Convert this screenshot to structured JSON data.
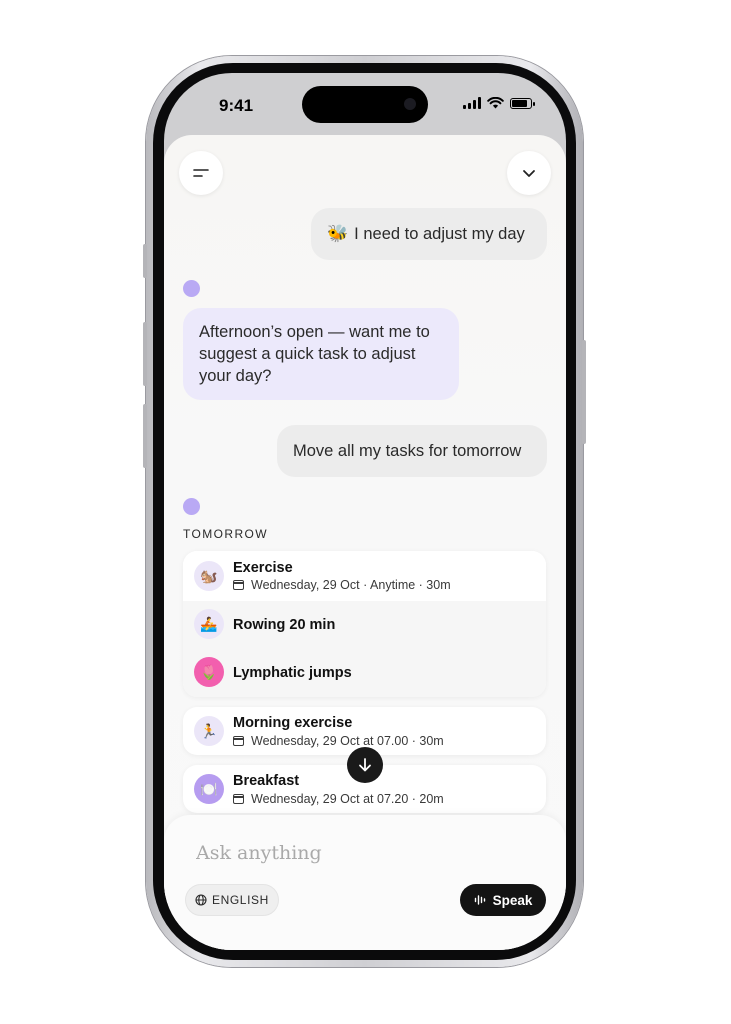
{
  "status_bar": {
    "time": "9:41",
    "battery_level": 0.85
  },
  "header": {
    "menu_icon": "menu-lines-icon",
    "collapse_icon": "chevron-down-icon"
  },
  "chat": {
    "messages": [
      {
        "role": "user",
        "emoji": "🐝",
        "text": "I need to adjust my day"
      },
      {
        "role": "assistant",
        "text": "Afternoon’s open — want me to suggest a quick task to adjust your day?"
      },
      {
        "role": "user",
        "text": "Move all my tasks for tomorrow"
      }
    ],
    "section_label": "TOMORROW",
    "group_card": {
      "tasks": [
        {
          "title": "Exercise",
          "meta": "Wednesday, 29 Oct · Anytime · 30m",
          "icon": "🐿️",
          "icon_bg": "#ebe6f8"
        },
        {
          "title": "Rowing 20 min",
          "icon": "🚣",
          "icon_bg": "#ebe6f8"
        },
        {
          "title": "Lymphatic jumps",
          "icon": "🌷",
          "icon_bg": "#f25fae"
        }
      ]
    },
    "task_cards": [
      {
        "title": "Morning exercise",
        "meta": "Wednesday, 29 Oct at 07.00 · 30m",
        "icon": "🏃",
        "icon_bg": "#ebe6f8"
      },
      {
        "title": "Breakfast",
        "meta": "Wednesday, 29 Oct at 07.20 · 20m",
        "icon": "🍽️",
        "icon_bg": "#b69cf0"
      }
    ]
  },
  "composer": {
    "placeholder": "Ask anything",
    "language_label": "ENGLISH",
    "speak_label": "Speak"
  },
  "colors": {
    "assistant_bubble": "#ece9fb",
    "user_bubble": "#ececec",
    "assistant_dot": "#b9a9f4",
    "speak_button": "#141414"
  }
}
